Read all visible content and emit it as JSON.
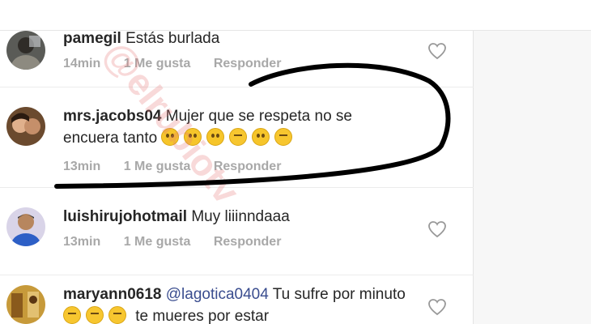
{
  "comments": [
    {
      "username": "pamegil",
      "text": "Estás burlada",
      "time": "14min",
      "likes": "1 Me gusta",
      "reply": "Responder",
      "avatar_icon": "user-photo-icon"
    },
    {
      "username": "mrs.jacobs04",
      "text": "Mujer que se respeta no se encuera tanto",
      "emojis": [
        "grinning-face",
        "grinning-face",
        "grinning-face",
        "face-with-tears-of-joy",
        "grinning-face",
        "face-with-tears-of-joy"
      ],
      "time": "13min",
      "likes": "1 Me gusta",
      "reply": "Responder",
      "avatar_icon": "user-photo-icon"
    },
    {
      "username": "luishirujohotmail",
      "text": "Muy liiinndaaa",
      "time": "13min",
      "likes": "1 Me gusta",
      "reply": "Responder",
      "avatar_icon": "user-photo-icon"
    },
    {
      "username": "maryann0618",
      "mention": "@lagotica0404",
      "text_a": "Tu sufre",
      "text_b": "por minuto",
      "text_c": "te mueres por estar",
      "emojis": [
        "face-with-tears-of-joy",
        "face-with-tears-of-joy",
        "face-with-tears-of-joy"
      ],
      "avatar_icon": "user-photo-icon"
    }
  ],
  "watermark": "@elrubiotv",
  "colors": {
    "text": "#262626",
    "meta": "#a8a8a8",
    "mention": "#3a4d8f",
    "annotation_ink": "#000000"
  }
}
